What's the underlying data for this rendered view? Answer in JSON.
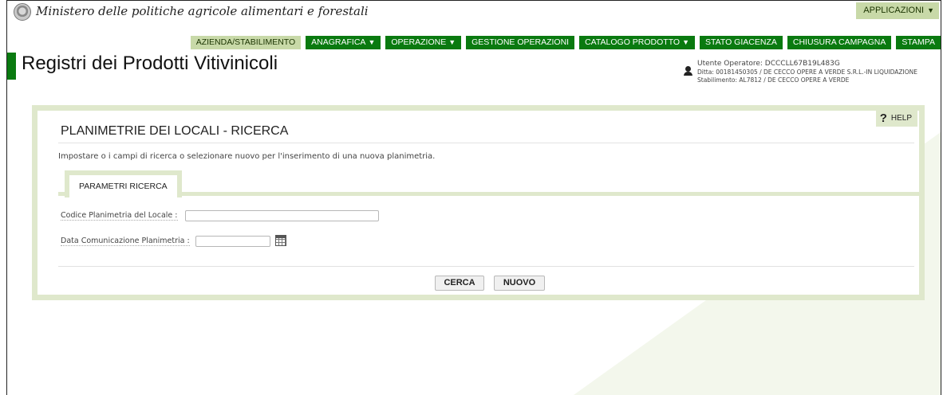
{
  "header": {
    "ministry": "Ministero delle politiche agricole alimentari e forestali",
    "apps_button": "APPLICAZIONI"
  },
  "nav": {
    "items": [
      {
        "label": "AZIENDA/STABILIMENTO",
        "dropdown": false,
        "active": true
      },
      {
        "label": "ANAGRAFICA",
        "dropdown": true,
        "active": false
      },
      {
        "label": "OPERAZIONE",
        "dropdown": true,
        "active": false
      },
      {
        "label": "GESTIONE OPERAZIONI",
        "dropdown": false,
        "active": false
      },
      {
        "label": "CATALOGO PRODOTTO",
        "dropdown": true,
        "active": false
      },
      {
        "label": "STATO GIACENZA",
        "dropdown": false,
        "active": false
      },
      {
        "label": "CHIUSURA CAMPAGNA",
        "dropdown": false,
        "active": false
      },
      {
        "label": "STAMPA",
        "dropdown": false,
        "active": false
      }
    ]
  },
  "page": {
    "title": "Registri dei Prodotti Vitivinicoli"
  },
  "user": {
    "operator": "Utente Operatore: DCCCLL67B19L483G",
    "company": "Ditta: 00181450305 / DE CECCO OPERE A VERDE S.R.L.-IN LIQUIDAZIONE",
    "plant": "Stabilimento: AL7812 / DE CECCO OPERE A VERDE"
  },
  "panel": {
    "help": "HELP",
    "title": "PLANIMETRIE DEI LOCALI - RICERCA",
    "instructions": "Impostare o i campi di ricerca o selezionare nuovo per l'inserimento di una nuova planimetria.",
    "tab": "PARAMETRI RICERCA",
    "fields": {
      "code_label": "Codice Planimetria del Locale :",
      "code_value": "",
      "date_label": "Data Comunicazione Planimetria :",
      "date_value": ""
    },
    "buttons": {
      "search": "CERCA",
      "new": "NUOVO"
    }
  },
  "colors": {
    "nav_green": "#0a7a10",
    "light_green": "#dfe8cc",
    "active_tab": "#c8d9a8"
  },
  "icons": {
    "emblem": "republic-emblem-icon",
    "dropdown": "caret-down-icon",
    "user": "user-icon",
    "help": "question-mark-icon",
    "calendar": "calendar-icon"
  }
}
